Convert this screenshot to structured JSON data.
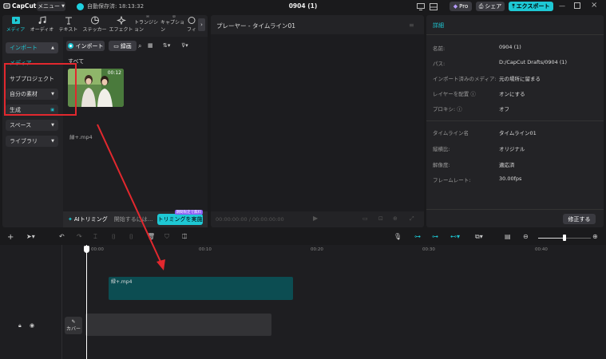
{
  "app": {
    "brand": "CapCut",
    "menu_label": "メニュー",
    "autosave": "自動保存済: 18:13:32",
    "project_title": "0904 (1)",
    "pro_label": "Pro",
    "share_label": "シェア",
    "export_label": "エクスポート"
  },
  "tabs": [
    {
      "label": "メディア"
    },
    {
      "label": "オーディオ"
    },
    {
      "label": "テキスト"
    },
    {
      "label": "ステッカー"
    },
    {
      "label": "エフェクト"
    },
    {
      "label": "トランジション"
    },
    {
      "label": "キャプション"
    },
    {
      "label": "フィ"
    }
  ],
  "leftnav": {
    "import": "インポート",
    "media": "メディア",
    "subproject": "サブプロジェクト",
    "mymaterial": "自分の素材",
    "generate": "生成",
    "space": "スペース",
    "library": "ライブラリ"
  },
  "media": {
    "import_btn": "インポート",
    "record_btn": "録画",
    "all": "すべて",
    "thumb_duration": "00:12",
    "filename": "緑+.mp4"
  },
  "aitrim": {
    "label": "AIトリミング",
    "placeholder": "開始するには...",
    "trim_btn": "トリミングを実施",
    "badge": "期間限定で無料"
  },
  "player": {
    "title": "プレーヤー - タイムライン01",
    "time": "00:00:00:00 / 00:00:00:00"
  },
  "details": {
    "title": "詳細",
    "rows": [
      {
        "k": "名前:",
        "v": "0904 (1)"
      },
      {
        "k": "パス:",
        "v": "D:/CapCut Drafts/0904 (1)"
      },
      {
        "k": "インポート済みのメディア:",
        "v": "元の場所に留まる"
      },
      {
        "k": "レイヤーを配置",
        "v": "オンにする"
      },
      {
        "k": "プロキシ:",
        "v": "オフ"
      },
      {
        "k": "タイムライン名",
        "v": "タイムライン01"
      },
      {
        "k": "縦横比:",
        "v": "オリジナル"
      },
      {
        "k": "解像度:",
        "v": "適応済"
      },
      {
        "k": "フレームレート:",
        "v": "30.00fps"
      }
    ],
    "fix_btn": "修正する"
  },
  "timeline": {
    "ticks": [
      "00:00",
      "00:10",
      "00:20",
      "00:30",
      "00:40"
    ],
    "clip_name": "緑+.mp4",
    "cover_label": "カバー"
  },
  "colors": {
    "accent": "#1ec8d4",
    "highlight": "#e2282e",
    "clip": "#0c4d52"
  }
}
